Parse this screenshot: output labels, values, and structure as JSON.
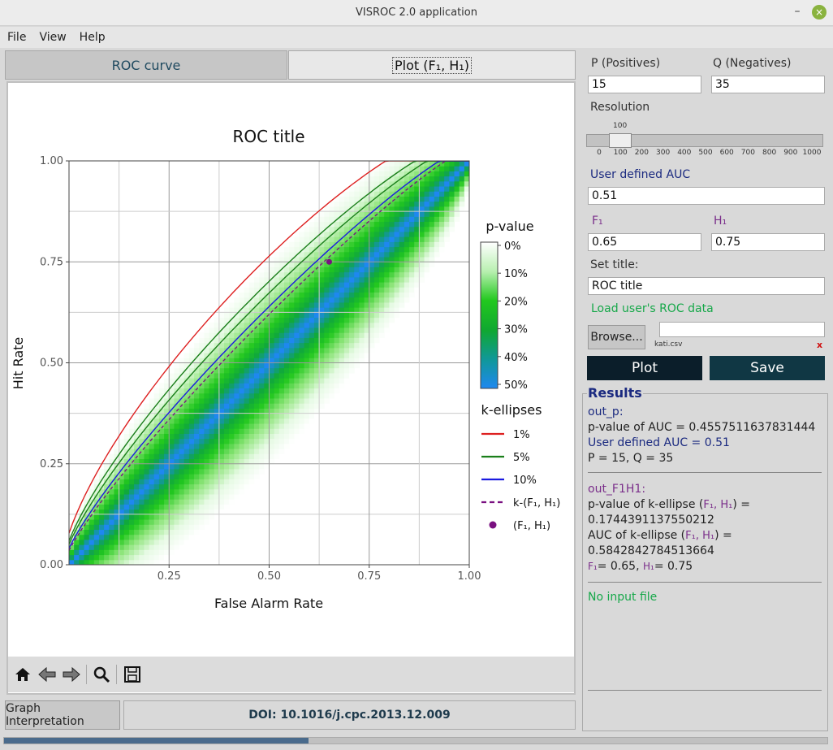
{
  "window": {
    "title": "VISROC 2.0 application",
    "minimize": "–",
    "close": "×"
  },
  "menu": [
    "File",
    "View",
    "Help"
  ],
  "tabs": {
    "roc": "ROC curve",
    "plot": "Plot (F₁, H₁)"
  },
  "chart_data": {
    "type": "heatmap",
    "title": "ROC title",
    "xlabel": "False Alarm Rate",
    "ylabel": "Hit Rate",
    "xlim": [
      0,
      1
    ],
    "ylim": [
      0,
      1
    ],
    "x_ticks": [
      "0.25",
      "0.50",
      "0.75",
      "1.00"
    ],
    "y_ticks": [
      "0.00",
      "0.25",
      "0.50",
      "0.75",
      "1.00"
    ],
    "grid": true,
    "colorbar": {
      "title": "p-value",
      "labels": [
        "0%",
        "10%",
        "20%",
        "30%",
        "40%",
        "50%"
      ]
    },
    "legend_title": "k-ellipses",
    "legend": [
      {
        "label": "1%",
        "color": "#dd2020",
        "style": "solid"
      },
      {
        "label": "5%",
        "color": "#1a7f1a",
        "style": "solid"
      },
      {
        "label": "10%",
        "color": "#1a1ae0",
        "style": "solid"
      },
      {
        "label": "k-(F₁, H₁)",
        "color": "#7a1080",
        "style": "dashed"
      },
      {
        "label": "(F₁, H₁)",
        "color": "#7a1080",
        "style": "marker"
      }
    ],
    "point": {
      "F": 0.65,
      "H": 0.75
    }
  },
  "toolbar": [
    "home-icon",
    "back-icon",
    "forward-icon",
    "zoom-icon",
    "save-icon"
  ],
  "bottom": {
    "interp": "Graph Interpretation",
    "doi": "DOI: 10.1016/j.cpc.2013.12.009",
    "progress": 0.37
  },
  "params": {
    "p_label": "P (Positives)",
    "q_label": "Q (Negatives)",
    "p_value": "15",
    "q_value": "35",
    "resolution_label": "Resolution",
    "resolution_value": "100",
    "resolution_ticks": [
      "0",
      "100",
      "200",
      "300",
      "400",
      "500",
      "600",
      "700",
      "800",
      "900",
      "1000"
    ],
    "auc_label": "User defined AUC",
    "auc_value": "0.51",
    "f1_label": "F₁",
    "h1_label": "H₁",
    "f1_value": "0.65",
    "h1_value": "0.75",
    "title_label": "Set title:",
    "title_value": "ROC title",
    "load_label": "Load user's ROC data",
    "browse": "Browse...",
    "file_name": "kati.csv",
    "clear": "x",
    "plot": "Plot",
    "save": "Save"
  },
  "results": {
    "title": "Results",
    "out_p": "out_p:",
    "pvalue_auc": "p-value of AUC = 0.4557511637831444",
    "user_auc": "User defined AUC = 0.51",
    "pq": "P = 15, Q = 35",
    "out_f1h1": "out_F1H1:",
    "pvalue_k_prefix": "p-value of k-ellipse (",
    "pvalue_k_fh": "F₁, H₁",
    "pvalue_k_suffix": ") =",
    "pvalue_k": "0.1744391137550212",
    "auc_k_prefix": "AUC of k-ellipse (",
    "auc_k_fh": "F₁, H₁",
    "auc_k_suffix": ") =",
    "auc_k": "0.5842842784513664",
    "fh_f": "F₁",
    "fh_f_val": "= 0.65, ",
    "fh_h": "H₁",
    "fh_h_val": "= 0.75",
    "no_input": "No input file"
  }
}
